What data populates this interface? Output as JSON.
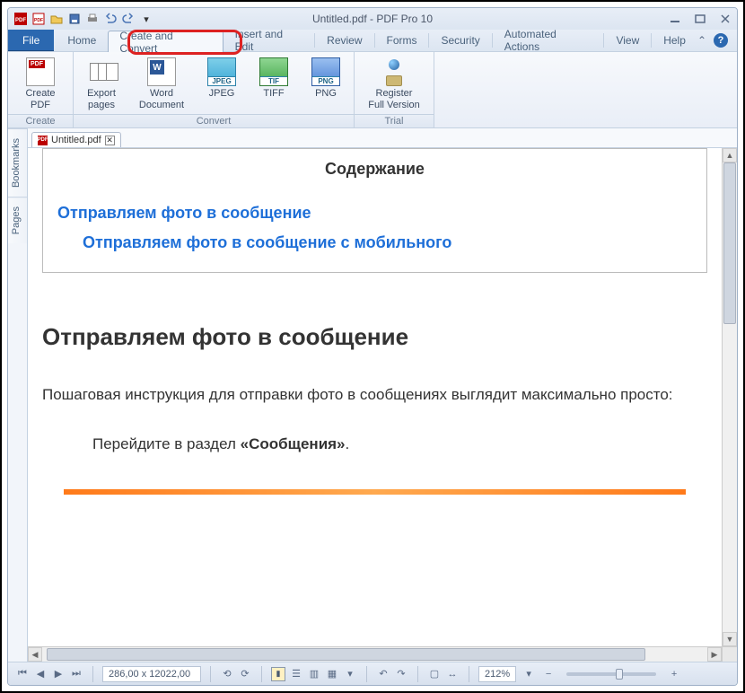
{
  "title": "Untitled.pdf - PDF Pro 10",
  "ribbon": {
    "file": "File",
    "tabs": {
      "home": "Home",
      "create": "Create and Convert",
      "insert": "Insert and Edit",
      "review": "Review",
      "forms": "Forms",
      "security": "Security",
      "automated": "Automated Actions",
      "view": "View",
      "help": "Help"
    }
  },
  "groups": {
    "create": {
      "label": "Create",
      "create_pdf": "Create\nPDF"
    },
    "convert": {
      "label": "Convert",
      "export_pages": "Export\npages",
      "word": "Word\nDocument",
      "jpeg": "JPEG",
      "tiff": "TIFF",
      "png": "PNG"
    },
    "trial": {
      "label": "Trial",
      "register": "Register\nFull Version"
    }
  },
  "sidebar": {
    "bookmarks": "Bookmarks",
    "pages": "Pages"
  },
  "doc_tab": {
    "name": "Untitled.pdf"
  },
  "document": {
    "toc_title": "Содержание",
    "toc_link1": "Отправляем фото в сообщение",
    "toc_link2": "Отправляем фото в сообщение с мобильного",
    "heading1": "Отправляем фото в сообщение",
    "para1": "Пошаговая инструкция для отправки фото в сообщениях выглядит максимально просто:",
    "step_prefix": "Перейдите в раздел ",
    "step_bold": "«Сообщения»",
    "step_suffix": "."
  },
  "statusbar": {
    "coords": "286,00 x 12022,00",
    "zoom": "212%"
  },
  "badges": {
    "pdf": "PDF",
    "jpeg": "JPEG",
    "tif": "TIF",
    "png": "PNG",
    "w": "W"
  }
}
